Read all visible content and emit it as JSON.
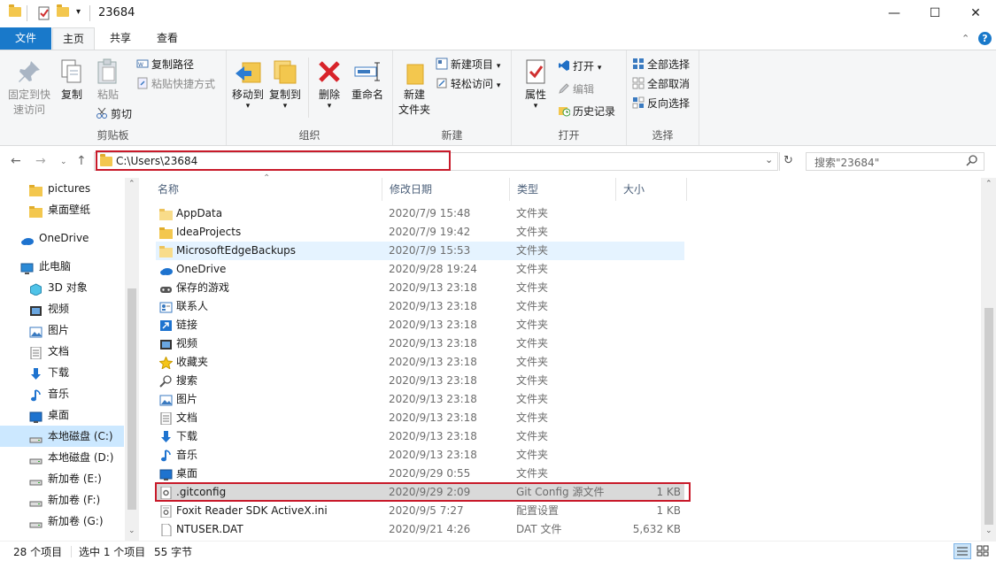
{
  "window": {
    "title": "23684",
    "minimize": "—",
    "maximize": "☐",
    "close": "✕"
  },
  "ribbon_tabs": [
    "文件",
    "主页",
    "共享",
    "查看"
  ],
  "ribbon": {
    "clipboard": {
      "pin": [
        "固定到快",
        "速访问"
      ],
      "copy": "复制",
      "paste": "粘贴",
      "copy_path": "复制路径",
      "paste_shortcut": "粘贴快捷方式",
      "cut": "剪切",
      "label": "剪贴板"
    },
    "organize": {
      "move_to": "移动到",
      "copy_to": "复制到",
      "delete": "删除",
      "rename": "重命名",
      "label": "组织"
    },
    "new": {
      "new_folder": [
        "新建",
        "文件夹"
      ],
      "new_item": "新建项目",
      "easy_access": "轻松访问",
      "label": "新建"
    },
    "open": {
      "properties": "属性",
      "open": "打开",
      "edit": "编辑",
      "history": "历史记录",
      "label": "打开"
    },
    "select": {
      "select_all": "全部选择",
      "select_none": "全部取消",
      "invert": "反向选择",
      "label": "选择"
    }
  },
  "address": {
    "path": "C:\\Users\\23684",
    "search_placeholder": "搜索\"23684\""
  },
  "nav": [
    {
      "label": "pictures",
      "icon": "folder-icon"
    },
    {
      "label": "桌面壁纸",
      "icon": "folder-icon"
    },
    {
      "label": "OneDrive",
      "icon": "cloud-icon"
    },
    {
      "label": "此电脑",
      "icon": "computer-icon"
    },
    {
      "label": "3D 对象",
      "icon": "cube-icon"
    },
    {
      "label": "视频",
      "icon": "video-icon"
    },
    {
      "label": "图片",
      "icon": "picture-icon"
    },
    {
      "label": "文档",
      "icon": "document-icon"
    },
    {
      "label": "下载",
      "icon": "download-icon"
    },
    {
      "label": "音乐",
      "icon": "music-icon"
    },
    {
      "label": "桌面",
      "icon": "desktop-icon"
    },
    {
      "label": "本地磁盘 (C:)",
      "icon": "drive-icon"
    },
    {
      "label": "本地磁盘 (D:)",
      "icon": "drive-icon"
    },
    {
      "label": "新加卷 (E:)",
      "icon": "drive-icon"
    },
    {
      "label": "新加卷 (F:)",
      "icon": "drive-icon"
    },
    {
      "label": "新加卷 (G:)",
      "icon": "drive-icon"
    }
  ],
  "columns": [
    "名称",
    "修改日期",
    "类型",
    "大小"
  ],
  "files": [
    {
      "name": "AppData",
      "date": "2020/7/9 15:48",
      "type": "文件夹",
      "size": "",
      "icon": "folder-light-icon"
    },
    {
      "name": "IdeaProjects",
      "date": "2020/7/9 19:42",
      "type": "文件夹",
      "size": "",
      "icon": "folder-icon"
    },
    {
      "name": "MicrosoftEdgeBackups",
      "date": "2020/7/9 15:53",
      "type": "文件夹",
      "size": "",
      "icon": "folder-light-icon"
    },
    {
      "name": "OneDrive",
      "date": "2020/9/28 19:24",
      "type": "文件夹",
      "size": "",
      "icon": "cloud-icon"
    },
    {
      "name": "保存的游戏",
      "date": "2020/9/13 23:18",
      "type": "文件夹",
      "size": "",
      "icon": "game-icon"
    },
    {
      "name": "联系人",
      "date": "2020/9/13 23:18",
      "type": "文件夹",
      "size": "",
      "icon": "contacts-icon"
    },
    {
      "name": "链接",
      "date": "2020/9/13 23:18",
      "type": "文件夹",
      "size": "",
      "icon": "link-icon"
    },
    {
      "name": "视频",
      "date": "2020/9/13 23:18",
      "type": "文件夹",
      "size": "",
      "icon": "video-icon"
    },
    {
      "name": "收藏夹",
      "date": "2020/9/13 23:18",
      "type": "文件夹",
      "size": "",
      "icon": "star-icon"
    },
    {
      "name": "搜索",
      "date": "2020/9/13 23:18",
      "type": "文件夹",
      "size": "",
      "icon": "search-icon"
    },
    {
      "name": "图片",
      "date": "2020/9/13 23:18",
      "type": "文件夹",
      "size": "",
      "icon": "picture-icon"
    },
    {
      "name": "文档",
      "date": "2020/9/13 23:18",
      "type": "文件夹",
      "size": "",
      "icon": "document-icon"
    },
    {
      "name": "下载",
      "date": "2020/9/13 23:18",
      "type": "文件夹",
      "size": "",
      "icon": "download-icon"
    },
    {
      "name": "音乐",
      "date": "2020/9/13 23:18",
      "type": "文件夹",
      "size": "",
      "icon": "music-icon"
    },
    {
      "name": "桌面",
      "date": "2020/9/29 0:55",
      "type": "文件夹",
      "size": "",
      "icon": "desktop-icon"
    },
    {
      "name": ".gitconfig",
      "date": "2020/9/29 2:09",
      "type": "Git Config 源文件",
      "size": "1 KB",
      "icon": "config-file-icon"
    },
    {
      "name": "Foxit Reader SDK ActiveX.ini",
      "date": "2020/9/5 7:27",
      "type": "配置设置",
      "size": "1 KB",
      "icon": "ini-file-icon"
    },
    {
      "name": "NTUSER.DAT",
      "date": "2020/9/21 4:26",
      "type": "DAT 文件",
      "size": "5,632 KB",
      "icon": "file-icon"
    }
  ],
  "status": {
    "count": "28 个项目",
    "selected": "选中 1 个项目",
    "size": "55 字节"
  }
}
